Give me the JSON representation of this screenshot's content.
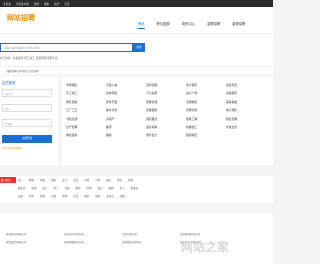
{
  "topbar": [
    "手机版",
    "手机客户端",
    "招聘",
    "求职",
    "简历",
    "首页"
  ],
  "logo": "网站招聘",
  "nav": [
    "首页",
    "职位搜索",
    "简历中心",
    "急聘招聘",
    "重磅招聘"
  ],
  "search": {
    "placeholder": "请输入职位或者企业名称关键字",
    "button": "搜索"
  },
  "hot": "热门搜索：外贸跟单  普工/技工  质量管理  销售代表",
  "ticker": "最新招聘  发布职位  企业招聘 ...",
  "login": {
    "title": "会员登录",
    "user": "用户名",
    "pass": "密码",
    "code": "验证码",
    "button": "立即登录",
    "register": "立即注册  找回密码"
  },
  "categories": [
    "市场销售",
    "行政人事",
    "法律法规",
    "客户服务",
    "运营专员",
    "普工技工",
    "文体传媒",
    "人力资源",
    "设计广告",
    "家政服务",
    "财务出纳",
    "软件开发",
    "质量管理",
    "仓储物流",
    "美容美发",
    "工厂工艺",
    "教育培训",
    "金融保险",
    "管理咨询",
    "电子通信",
    "司机交通",
    "房地产",
    "酒店餐饮",
    "建筑工程",
    "物业管理",
    "生产管理",
    "翻译",
    "贸易采购",
    "机械技工",
    "外贸业务",
    "电商运营",
    "编辑",
    "财务会计",
    "其他职位"
  ],
  "tags": {
    "head": "热门职位",
    "row1": [
      "普工",
      "客服",
      "司机",
      "销售",
      "会计",
      "文员",
      "行政",
      "人事",
      "保安",
      "保洁",
      "厨师"
    ],
    "row2": [
      "服务员",
      "收银",
      "电工",
      "焊工",
      "仓管",
      "跟单",
      "导购",
      "设计",
      "编辑",
      "美工",
      "快递员"
    ],
    "row3": [
      "店长",
      "前台",
      "助理",
      "主管",
      "经理",
      "专员",
      "质检",
      "采购",
      "业务员",
      "代理"
    ]
  },
  "list": [
    [
      "某某科技有限公司",
      "某某电子有限公司",
      "某某贸易公司",
      "某某物流有限公司"
    ],
    [
      "某某制造有限公司",
      "某某网络科技公司",
      "某某教育培训中心",
      "某某服饰有限公司"
    ]
  ],
  "watermark": "网站之家"
}
